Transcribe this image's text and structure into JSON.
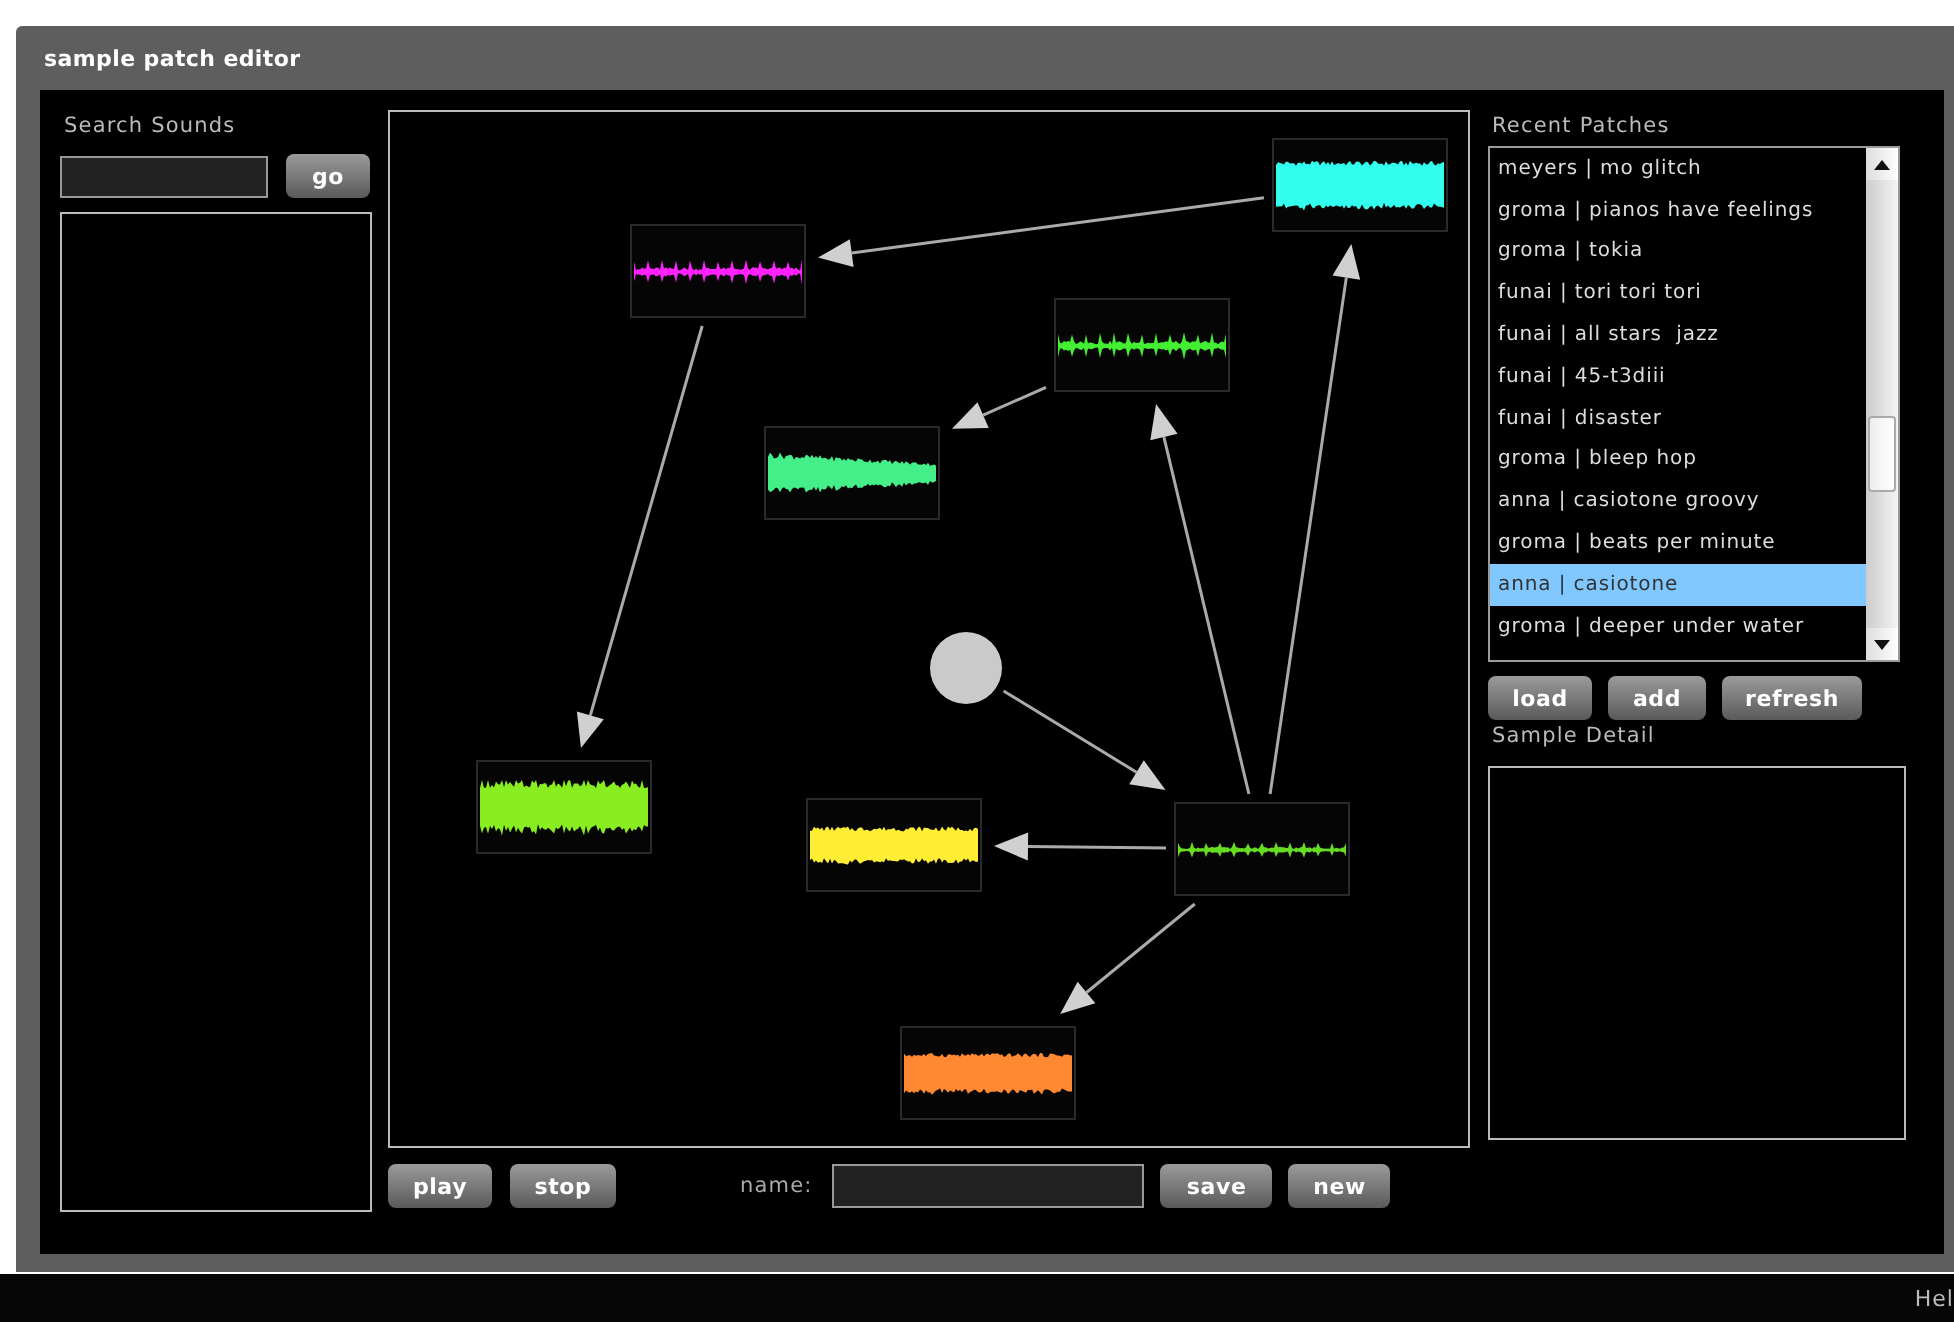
{
  "window": {
    "title": "sample patch editor"
  },
  "search": {
    "label": "Search Sounds",
    "button": "go"
  },
  "patch": {
    "nodes": [
      {
        "kind": "sample",
        "color": "#33ffee"
      },
      {
        "kind": "sample",
        "color": "#ff22ff"
      },
      {
        "kind": "sample",
        "color": "#44ee33"
      },
      {
        "kind": "sample",
        "color": "#44ee88"
      },
      {
        "kind": "source"
      },
      {
        "kind": "sample",
        "color": "#88ee22"
      },
      {
        "kind": "sample",
        "color": "#ffee33"
      },
      {
        "kind": "sample",
        "color": "#66dd22"
      },
      {
        "kind": "sample",
        "color": "#ff8833"
      }
    ]
  },
  "controls": {
    "play": "play",
    "stop": "stop",
    "name_label": "name:",
    "save": "save",
    "new": "new"
  },
  "recent_patches": {
    "label": "Recent Patches",
    "items": [
      {
        "text": "meyers | mo glitch",
        "selected": false
      },
      {
        "text": "groma | pianos have feelings",
        "selected": false
      },
      {
        "text": "groma | tokia",
        "selected": false
      },
      {
        "text": "funai | tori tori tori",
        "selected": false
      },
      {
        "text": "funai | all stars  jazz",
        "selected": false
      },
      {
        "text": "funai | 45-t3diii",
        "selected": false
      },
      {
        "text": "funai | disaster",
        "selected": false
      },
      {
        "text": "groma | bleep hop",
        "selected": false
      },
      {
        "text": "anna | casiotone groovy",
        "selected": false
      },
      {
        "text": "groma | beats per minute",
        "selected": false
      },
      {
        "text": "anna | casiotone",
        "selected": true
      },
      {
        "text": "groma | deeper under water",
        "selected": false
      }
    ],
    "buttons": [
      "load",
      "add",
      "refresh"
    ]
  },
  "sample_detail": {
    "label": "Sample Detail"
  },
  "status_bar": {
    "text": "Hel"
  }
}
